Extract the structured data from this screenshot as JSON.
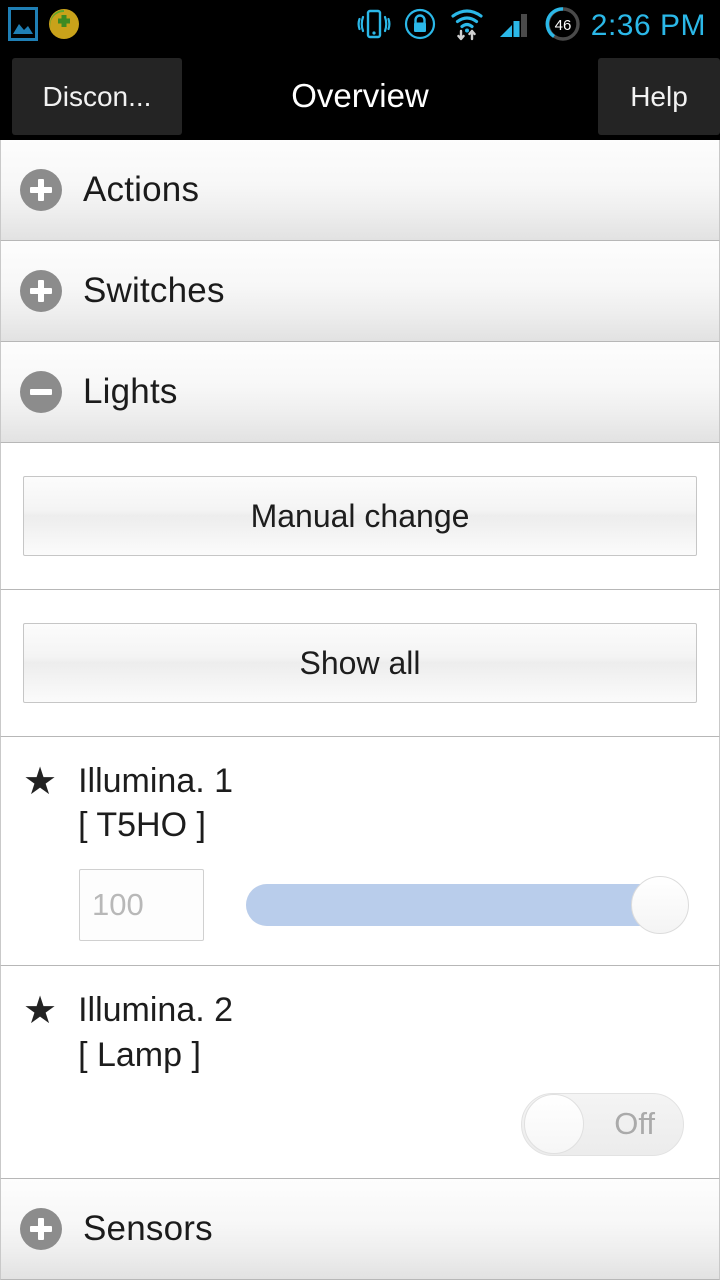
{
  "statusbar": {
    "time": "2:36 PM",
    "battery_percent": "46",
    "left_icons": [
      {
        "name": "gallery-icon"
      },
      {
        "name": "security-shield-icon"
      }
    ],
    "right_icons": [
      {
        "name": "vibrate-icon"
      },
      {
        "name": "lock-icon"
      },
      {
        "name": "wifi-data-icon"
      },
      {
        "name": "signal-bars-icon"
      },
      {
        "name": "battery-circle-icon"
      }
    ]
  },
  "titlebar": {
    "back_label": "Discon...",
    "title": "Overview",
    "help_label": "Help"
  },
  "sections": [
    {
      "label": "Actions",
      "state": "collapsed",
      "icon": "plus-circle-icon"
    },
    {
      "label": "Switches",
      "state": "collapsed",
      "icon": "plus-circle-icon"
    },
    {
      "label": "Lights",
      "state": "expanded",
      "icon": "minus-circle-icon"
    },
    {
      "label": "Sensors",
      "state": "collapsed",
      "icon": "plus-circle-icon"
    }
  ],
  "lights_panel": {
    "manual_change_label": "Manual change",
    "show_all_label": "Show all"
  },
  "devices": [
    {
      "star": "★",
      "title": "Illumina. 1",
      "subtitle": "[ T5HO ]",
      "control": "slider",
      "value": "100",
      "placeholder": "100",
      "slider_percent": "100"
    },
    {
      "star": "★",
      "title": "Illumina. 2",
      "subtitle": "[ Lamp ]",
      "control": "toggle",
      "toggle_label": "Off",
      "toggle_state": "off"
    }
  ],
  "colors": {
    "accent_blue": "#2bb8e8",
    "slider_fill": "#b9cdeb",
    "statusbar_bg": "#000000",
    "section_icon": "#8c8c8c"
  }
}
